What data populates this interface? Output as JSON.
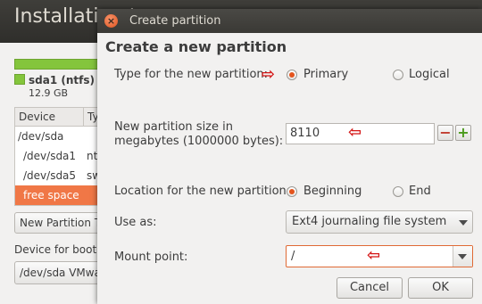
{
  "background": {
    "window_title": "Installation type",
    "partition_legend": "sda1 (ntfs)",
    "partition_size": "12.9 GB",
    "table": {
      "headers": [
        "Device",
        "Type"
      ],
      "rows": [
        {
          "device": "/dev/sda",
          "type": ""
        },
        {
          "device": "/dev/sda1",
          "type": "ntfs"
        },
        {
          "device": "/dev/sda5",
          "type": "swap"
        },
        {
          "device": "free space",
          "type": ""
        }
      ]
    },
    "new_partition_button": "New Partition Table...",
    "boot_device_label": "Device for boot loader installation:",
    "boot_device_value": "/dev/sda   VMware"
  },
  "dialog": {
    "title": "Create partition",
    "heading": "Create a new partition",
    "type": {
      "label": "Type for the new partition:",
      "options": [
        "Primary",
        "Logical"
      ],
      "selected": "Primary"
    },
    "size": {
      "label_line1": "New partition size in",
      "label_line2": "megabytes (1000000 bytes):",
      "value": "8110",
      "minus": "−",
      "plus": "+"
    },
    "location": {
      "label": "Location for the new partition:",
      "options": [
        "Beginning",
        "End"
      ],
      "selected": "Beginning"
    },
    "use_as": {
      "label": "Use as:",
      "value": "Ext4 journaling file system"
    },
    "mount": {
      "label": "Mount point:",
      "value": "/"
    },
    "buttons": {
      "cancel": "Cancel",
      "ok": "OK"
    }
  },
  "icons": {
    "close": "close-icon",
    "arrow": "red-arrow-annotation"
  },
  "colors": {
    "accent": "#e4541d",
    "selected_row": "#f07746",
    "annotation": "#d41414",
    "usage_bar": "#84c53c"
  }
}
